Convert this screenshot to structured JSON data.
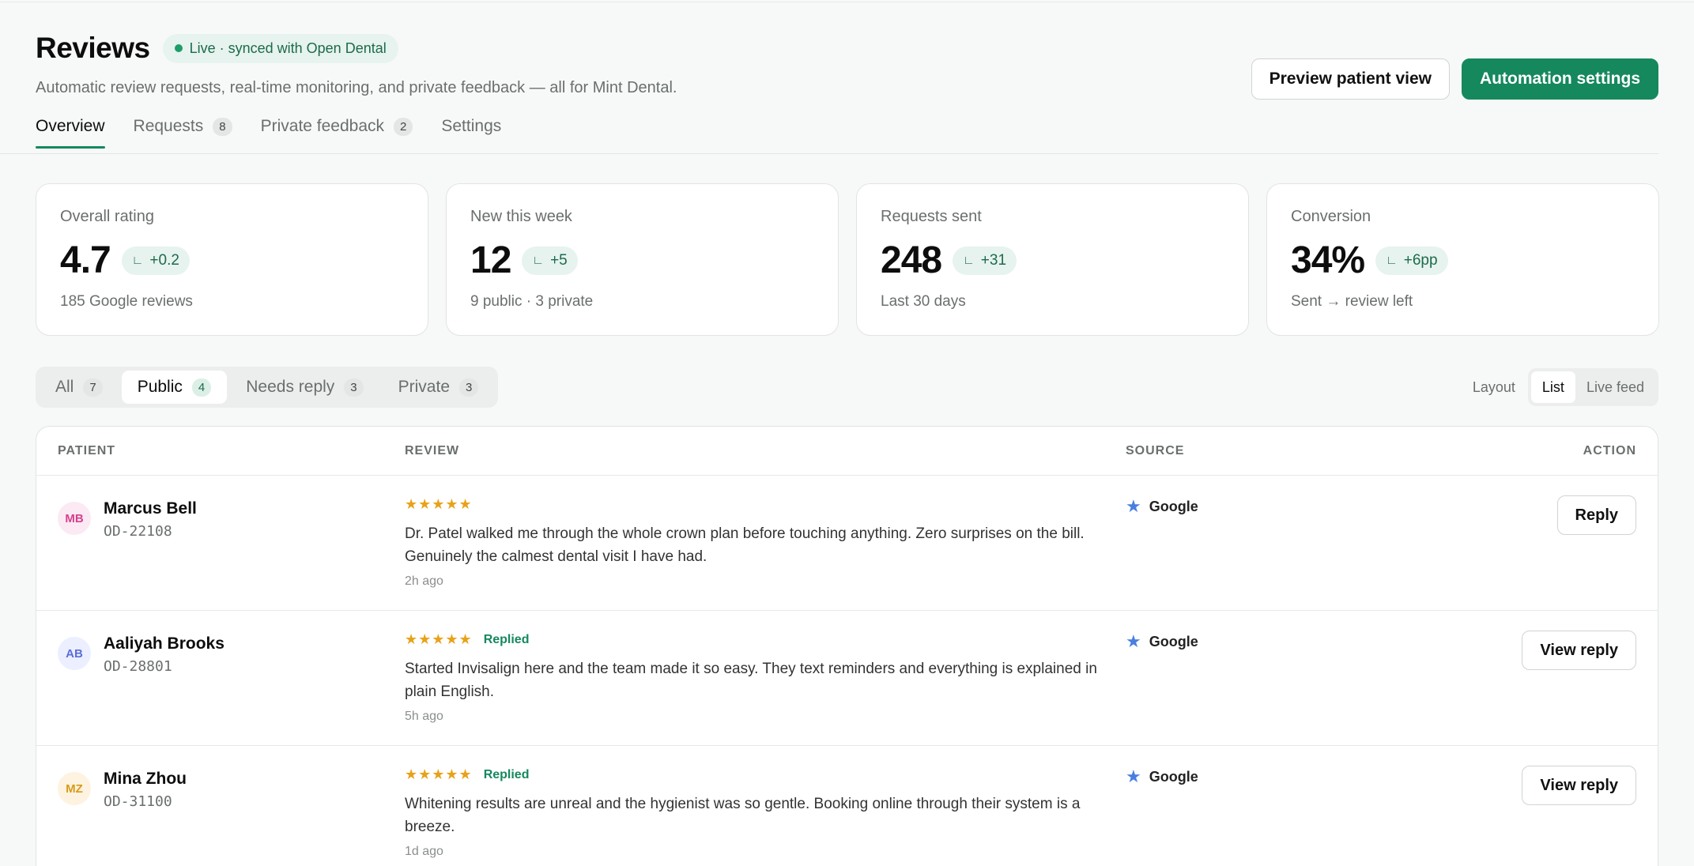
{
  "header": {
    "title": "Reviews",
    "live_badge": "Live · synced with Open Dental",
    "subtitle": "Automatic review requests, real-time monitoring, and private feedback — all for Mint Dental.",
    "preview_label": "Preview patient view",
    "automation_label": "Automation settings"
  },
  "tabs": [
    {
      "label": "Overview",
      "count": null
    },
    {
      "label": "Requests",
      "count": "8"
    },
    {
      "label": "Private feedback",
      "count": "2"
    },
    {
      "label": "Settings",
      "count": null
    }
  ],
  "stats": [
    {
      "label": "Overall rating",
      "value": "4.7",
      "delta": "+0.2",
      "sub": "185 Google reviews"
    },
    {
      "label": "New this week",
      "value": "12",
      "delta": "+5",
      "sub": "9 public · 3 private"
    },
    {
      "label": "Requests sent",
      "value": "248",
      "delta": "+31",
      "sub": "Last 30 days"
    },
    {
      "label": "Conversion",
      "value": "34%",
      "delta": "+6pp",
      "sub": "Sent → review left"
    }
  ],
  "filters": [
    {
      "label": "All",
      "count": "7"
    },
    {
      "label": "Public",
      "count": "4"
    },
    {
      "label": "Needs reply",
      "count": "3"
    },
    {
      "label": "Private",
      "count": "3"
    }
  ],
  "layout": {
    "label": "Layout",
    "list": "List",
    "live_feed": "Live feed"
  },
  "table": {
    "headers": {
      "patient": "PATIENT",
      "review": "REVIEW",
      "source": "SOURCE",
      "action": "ACTION"
    },
    "rows": [
      {
        "initials": "MB",
        "avatar_color": "#d6408f",
        "avatar_bg": "#fbeaf3",
        "name": "Marcus Bell",
        "id": "OD-22108",
        "stars": "★★★★★",
        "replied": "",
        "text": "Dr. Patel walked me through the whole crown plan before touching anything. Zero surprises on the bill. Genuinely the calmest dental visit I have had.",
        "time": "2h ago",
        "source": "Google",
        "action": "Reply"
      },
      {
        "initials": "AB",
        "avatar_color": "#5b6fd6",
        "avatar_bg": "#ecefff",
        "name": "Aaliyah Brooks",
        "id": "OD-28801",
        "stars": "★★★★★",
        "replied": "Replied",
        "text": "Started Invisalign here and the team made it so easy. They text reminders and everything is explained in plain English.",
        "time": "5h ago",
        "source": "Google",
        "action": "View reply"
      },
      {
        "initials": "MZ",
        "avatar_color": "#d99a17",
        "avatar_bg": "#fdf3e0",
        "name": "Mina Zhou",
        "id": "OD-31100",
        "stars": "★★★★★",
        "replied": "Replied",
        "text": "Whitening results are unreal and the hygienist was so gentle. Booking online through their system is a breeze.",
        "time": "1d ago",
        "source": "Google",
        "action": "View reply"
      }
    ]
  }
}
